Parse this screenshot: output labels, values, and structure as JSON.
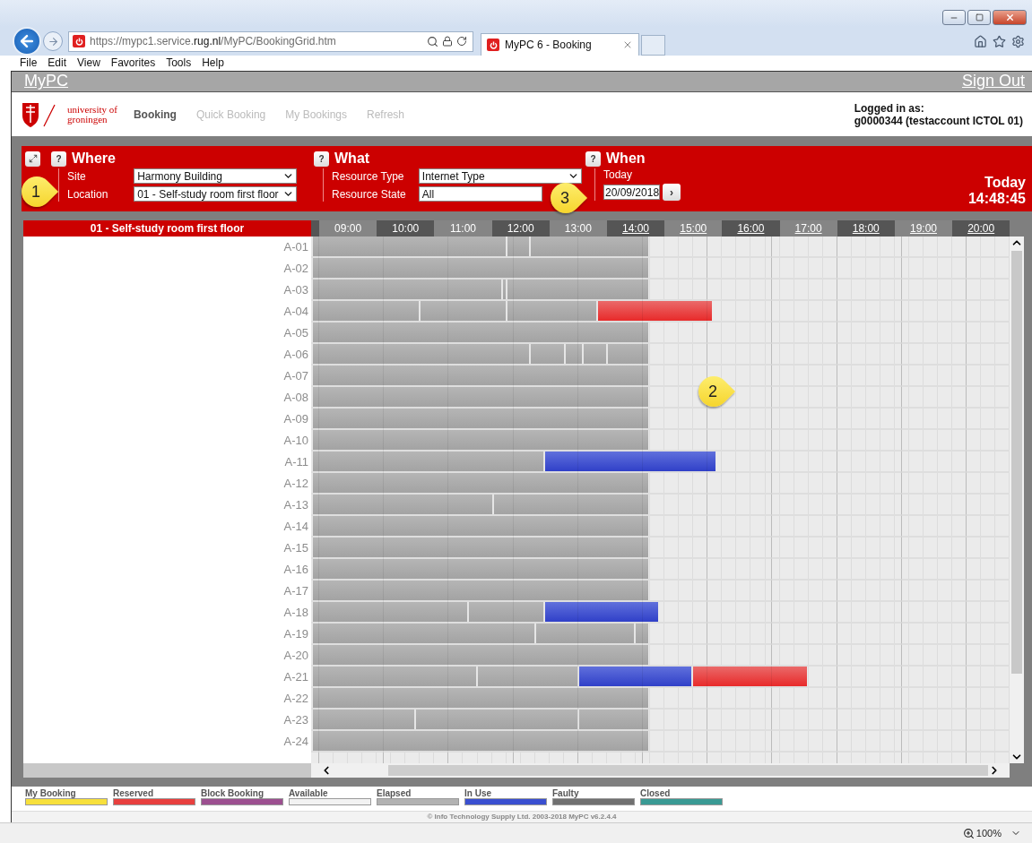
{
  "browser": {
    "url": "https://mypc1.service.**rug.nl**/MyPC/BookingGrid.htm",
    "tab": "MyPC 6 - Booking",
    "menu": [
      "File",
      "Edit",
      "View",
      "Favorites",
      "Tools",
      "Help"
    ],
    "zoom": "100%"
  },
  "header": {
    "brand": "MyPC",
    "sign_out": "Sign Out"
  },
  "nav": {
    "logo": [
      "university of",
      "groningen"
    ],
    "items": [
      {
        "label": "Booking",
        "selected": true
      },
      {
        "label": "Quick Booking",
        "selected": false
      },
      {
        "label": "My Bookings",
        "selected": false
      },
      {
        "label": "Refresh",
        "selected": false
      }
    ],
    "logged_in_label": "Logged in as:",
    "user": "g0000344 (testaccount ICTOL 01)"
  },
  "filters": {
    "help": "?",
    "where": {
      "title": "Where",
      "fields": [
        {
          "label": "Site",
          "value": "Harmony Building",
          "kind": "select"
        },
        {
          "label": "Location",
          "value": "01 - Self-study room first floor",
          "kind": "select"
        }
      ]
    },
    "what": {
      "title": "What",
      "fields": [
        {
          "label": "Resource Type",
          "value": "Internet Type",
          "kind": "select"
        },
        {
          "label": "Resource State",
          "value": "All",
          "kind": "input"
        }
      ]
    },
    "when": {
      "title": "When",
      "label": "Today",
      "date": "20/09/2018",
      "next": "›"
    },
    "clock": {
      "day": "Today",
      "time": "14:48:45"
    }
  },
  "grid": {
    "title": "01 - Self-study room first floor",
    "hours": [
      {
        "label": "09:00",
        "link": false
      },
      {
        "label": "10:00",
        "link": false
      },
      {
        "label": "11:00",
        "link": false
      },
      {
        "label": "12:00",
        "link": false
      },
      {
        "label": "13:00",
        "link": false
      },
      {
        "label": "14:00",
        "link": true
      },
      {
        "label": "15:00",
        "link": true
      },
      {
        "label": "16:00",
        "link": true
      },
      {
        "label": "17:00",
        "link": true
      },
      {
        "label": "18:00",
        "link": true
      },
      {
        "label": "19:00",
        "link": true
      },
      {
        "label": "20:00",
        "link": true
      }
    ],
    "rows": [
      {
        "label": "A-01",
        "bookings": [
          {
            "kind": "elapsed"
          },
          {
            "kind": "elapsed"
          },
          {
            "kind": "elapsed"
          }
        ]
      },
      {
        "label": "A-02",
        "bookings": [
          {
            "kind": "elapsed"
          }
        ]
      },
      {
        "label": "A-03",
        "bookings": [
          {
            "kind": "elapsed"
          },
          {
            "kind": "elapsed"
          },
          {
            "kind": "elapsed"
          }
        ]
      },
      {
        "label": "A-04",
        "bookings": [
          {
            "kind": "elapsed"
          },
          {
            "kind": "elapsed"
          },
          {
            "kind": "elapsed"
          },
          {
            "kind": "reserved"
          }
        ]
      },
      {
        "label": "A-05",
        "bookings": [
          {
            "kind": "elapsed"
          }
        ]
      },
      {
        "label": "A-06",
        "bookings": [
          {
            "kind": "elapsed"
          },
          {
            "kind": "elapsed"
          },
          {
            "kind": "elapsed"
          },
          {
            "kind": "elapsed"
          },
          {
            "kind": "elapsed"
          }
        ]
      },
      {
        "label": "A-07",
        "bookings": [
          {
            "kind": "elapsed"
          }
        ]
      },
      {
        "label": "A-08",
        "bookings": [
          {
            "kind": "elapsed"
          }
        ]
      },
      {
        "label": "A-09",
        "bookings": [
          {
            "kind": "elapsed"
          }
        ]
      },
      {
        "label": "A-10",
        "bookings": [
          {
            "kind": "elapsed"
          }
        ]
      },
      {
        "label": "A-11",
        "bookings": [
          {
            "kind": "elapsed"
          },
          {
            "kind": "in_use"
          }
        ]
      },
      {
        "label": "A-12",
        "bookings": [
          {
            "kind": "elapsed"
          }
        ]
      },
      {
        "label": "A-13",
        "bookings": [
          {
            "kind": "elapsed"
          },
          {
            "kind": "elapsed"
          }
        ]
      },
      {
        "label": "A-14",
        "bookings": [
          {
            "kind": "elapsed"
          }
        ]
      },
      {
        "label": "A-15",
        "bookings": [
          {
            "kind": "elapsed"
          }
        ]
      },
      {
        "label": "A-16",
        "bookings": [
          {
            "kind": "elapsed"
          }
        ]
      },
      {
        "label": "A-17",
        "bookings": [
          {
            "kind": "elapsed"
          }
        ]
      },
      {
        "label": "A-18",
        "bookings": [
          {
            "kind": "elapsed"
          },
          {
            "kind": "elapsed"
          },
          {
            "kind": "in_use"
          }
        ]
      },
      {
        "label": "A-19",
        "bookings": [
          {
            "kind": "elapsed"
          },
          {
            "kind": "elapsed"
          },
          {
            "kind": "elapsed"
          }
        ]
      },
      {
        "label": "A-20",
        "bookings": [
          {
            "kind": "elapsed"
          }
        ]
      },
      {
        "label": "A-21",
        "bookings": [
          {
            "kind": "elapsed"
          },
          {
            "kind": "elapsed"
          },
          {
            "kind": "in_use"
          },
          {
            "kind": "reserved"
          }
        ]
      },
      {
        "label": "A-22",
        "bookings": [
          {
            "kind": "elapsed"
          }
        ]
      },
      {
        "label": "A-23",
        "bookings": [
          {
            "kind": "elapsed"
          },
          {
            "kind": "elapsed"
          },
          {
            "kind": "elapsed"
          }
        ]
      },
      {
        "label": "A-24",
        "bookings": [
          {
            "kind": "elapsed"
          }
        ]
      }
    ]
  },
  "legend": [
    {
      "label": "My Booking",
      "color": "#f7e03c"
    },
    {
      "label": "Reserved",
      "color": "#e8403f"
    },
    {
      "label": "Block Booking",
      "color": "#9c4f90"
    },
    {
      "label": "Available",
      "color": "#f2f2f2"
    },
    {
      "label": "Elapsed",
      "color": "#b2b2b2"
    },
    {
      "label": "In Use",
      "color": "#3a4fd0"
    },
    {
      "label": "Faulty",
      "color": "#707070"
    },
    {
      "label": "Closed",
      "color": "#3a9a94"
    }
  ],
  "footer": "© Info Technology Supply Ltd. 2003-2018 MyPC v6.2.4.4",
  "callouts": [
    {
      "text": "1"
    },
    {
      "text": "2"
    },
    {
      "text": "3"
    }
  ]
}
